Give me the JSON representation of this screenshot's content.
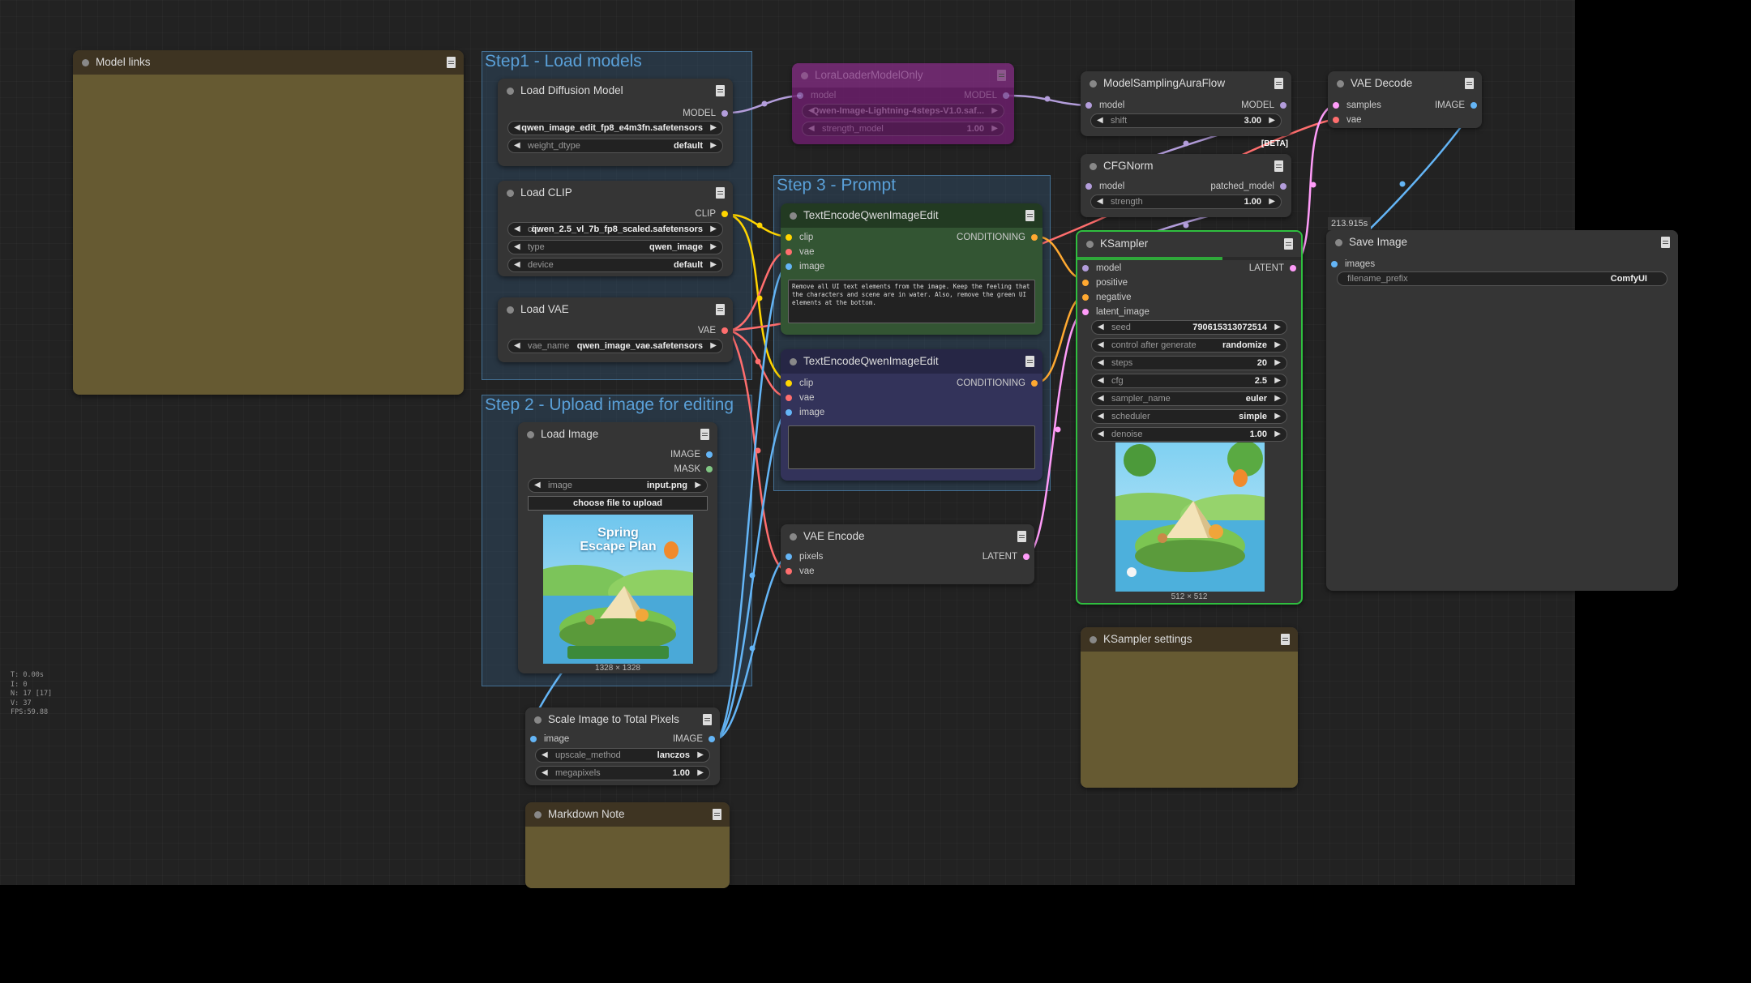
{
  "groups": {
    "step1": "Step1 - Load models",
    "step2": "Step 2 - Upload image for editing",
    "step3": "Step 3 - Prompt"
  },
  "notes": {
    "model_links": "Model links",
    "ksampler_settings": "KSampler settings",
    "markdown_note": "Markdown Note"
  },
  "load_diffusion": {
    "title": "Load Diffusion Model",
    "out_model": "MODEL",
    "unet_name": "qwen_image_edit_fp8_e4m3fn.safetensors",
    "weight_dtype_label": "weight_dtype",
    "weight_dtype": "default"
  },
  "load_clip": {
    "title": "Load CLIP",
    "out_clip": "CLIP",
    "clip_name_label": "cli...",
    "clip_name": "qwen_2.5_vl_7b_fp8_scaled.safetensors",
    "type_label": "type",
    "type": "qwen_image",
    "device_label": "device",
    "device": "default"
  },
  "load_vae": {
    "title": "Load VAE",
    "out_vae": "VAE",
    "vae_name_label": "vae_name",
    "vae_name": "qwen_image_vae.safetensors"
  },
  "load_image": {
    "title": "Load Image",
    "out_image": "IMAGE",
    "out_mask": "MASK",
    "image_label": "image",
    "image": "input.png",
    "upload": "choose file to upload",
    "dims": "1328 × 1328",
    "thumb_title_1": "Spring",
    "thumb_title_2": "Escape Plan"
  },
  "scale_image": {
    "title": "Scale Image to Total Pixels",
    "in_image": "image",
    "out_image": "IMAGE",
    "upscale_label": "upscale_method",
    "upscale": "lanczos",
    "mp_label": "megapixels",
    "mp": "1.00"
  },
  "lora": {
    "title": "LoraLoaderModelOnly",
    "in_model": "model",
    "out_model": "MODEL",
    "lora_name": "Qwen-Image-Lightning-4steps-V1.0.saf...",
    "strength_label": "strength_model",
    "strength": "1.00"
  },
  "encode1": {
    "title": "TextEncodeQwenImageEdit",
    "in_clip": "clip",
    "in_vae": "vae",
    "in_image": "image",
    "out": "CONDITIONING",
    "prompt": "Remove all UI text elements from the image. Keep the feeling that the characters and scene are in water. Also, remove the green UI elements at the bottom."
  },
  "encode2": {
    "title": "TextEncodeQwenImageEdit",
    "in_clip": "clip",
    "in_vae": "vae",
    "in_image": "image",
    "out": "CONDITIONING",
    "prompt": ""
  },
  "vae_encode": {
    "title": "VAE Encode",
    "in_pixels": "pixels",
    "in_vae": "vae",
    "out": "LATENT"
  },
  "aura": {
    "title": "ModelSamplingAuraFlow",
    "in_model": "model",
    "out_model": "MODEL",
    "shift_label": "shift",
    "shift": "3.00",
    "badge": "[BETA]"
  },
  "cfgnorm": {
    "title": "CFGNorm",
    "in_model": "model",
    "out": "patched_model",
    "strength_label": "strength",
    "strength": "1.00"
  },
  "ksampler": {
    "title": "KSampler",
    "in_model": "model",
    "in_positive": "positive",
    "in_negative": "negative",
    "in_latent": "latent_image",
    "out": "LATENT",
    "progress": 0.65,
    "widgets": [
      {
        "label": "seed",
        "value": "790615313072514"
      },
      {
        "label": "control after generate",
        "value": "randomize"
      },
      {
        "label": "steps",
        "value": "20"
      },
      {
        "label": "cfg",
        "value": "2.5"
      },
      {
        "label": "sampler_name",
        "value": "euler"
      },
      {
        "label": "scheduler",
        "value": "simple"
      },
      {
        "label": "denoise",
        "value": "1.00"
      }
    ],
    "dims": "512 × 512"
  },
  "vae_decode": {
    "title": "VAE Decode",
    "in_samples": "samples",
    "in_vae": "vae",
    "out": "IMAGE"
  },
  "save_image": {
    "title": "Save Image",
    "timing": "213.915s",
    "in_images": "images",
    "prefix_label": "filename_prefix",
    "prefix": "ComfyUI"
  },
  "stats": {
    "t": "T: 0.00s",
    "i": "I: 0",
    "n": "N: 17 [17]",
    "v": "V: 37",
    "fps": "FPS:59.88"
  },
  "colors": {
    "model": "#b39ddb",
    "clip": "#ffd500",
    "vae": "#ff6e6e",
    "image": "#64b5f6",
    "latent": "#ff9cf9",
    "conditioning": "#ffa931",
    "mask": "#81c784"
  }
}
